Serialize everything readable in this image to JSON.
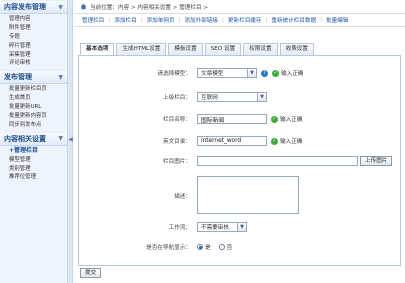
{
  "sidebar": {
    "sections": [
      {
        "title": "内容发布管理",
        "items": [
          "管理内容",
          "附件管理",
          "专题",
          "碎片管理",
          "采集管理",
          "评论审核"
        ]
      },
      {
        "title": "发布管理",
        "items": [
          "批量更新栏目页",
          "生成首页",
          "批量更新URL",
          "批量更新内容页",
          "同步到发布点"
        ]
      },
      {
        "title": "内容相关设置",
        "items": [
          "+管理栏目",
          "模型管理",
          "类别管理",
          "推荐位管理"
        ]
      }
    ]
  },
  "breadcrumb": "当前位置：内容 > 内容相关设置 > 管理栏目 >",
  "topnav": [
    "管理栏目",
    "添加栏目",
    "添加单网页",
    "添加外部链接",
    "更新栏目缓存",
    "重新统计栏目数据",
    "批量编辑"
  ],
  "tabs": [
    "基本选项",
    "生成HTML设置",
    "模板设置",
    "SEO 设置",
    "权限设置",
    "收费设置"
  ],
  "form": {
    "model_label": "请选择模型：",
    "model_value": "文章模型",
    "input_ok": "输入正确",
    "parent_label": "上级栏目：",
    "parent_value": "互联网",
    "name_label": "栏目名称：",
    "name_value": "国际新闻",
    "dir_label": "英文目录：",
    "dir_value": "internet_word",
    "image_label": "栏目图片：",
    "upload_label": "上传图片",
    "desc_label": "描述：",
    "workflow_label": "工作流：",
    "workflow_value": "不需要审核",
    "nav_label": "是否在导航显示：",
    "yes": "是",
    "no": "否"
  },
  "submit_label": "提交",
  "colors": {
    "link": "#1d57a8",
    "ok": "#3ea83a",
    "sidebar_bg": "#eef4fb"
  }
}
